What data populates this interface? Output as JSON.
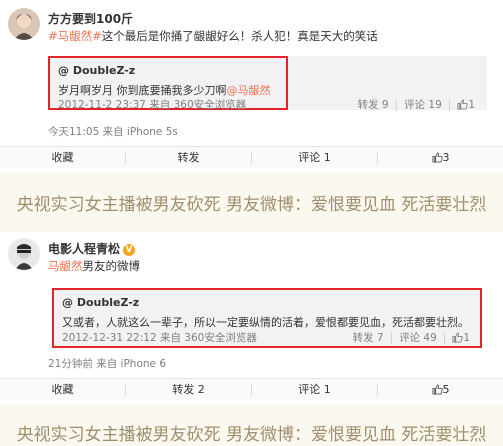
{
  "post1": {
    "author": "方方要到100斤",
    "hashtag": "#马龈然#",
    "text": "这个最后是你捅了龈龈好么！杀人犯！真是天大的笑话",
    "quote": {
      "username": "@ DoubleZ-z",
      "body_prefix": "岁月啊岁月 你到底要捅我多少刀啊",
      "body_tag": "@马龈然",
      "meta": "2012-11-2 23:37 来自 360安全浏览器",
      "repost": "转发 9",
      "comment": "评论 19",
      "likes": "1"
    },
    "meta": "今天11:05 来自 iPhone 5s",
    "actions": {
      "collect": "收藏",
      "repost": "转发",
      "comment": "评论 1",
      "likes": "3"
    }
  },
  "caption1": "央视实习女主播被男友砍死  男友微博：爱恨要见血  死活要壮烈",
  "post2": {
    "author": "电影人程青松",
    "verified_badge": "V",
    "text_tag": "马龈然",
    "text_rest": "男友的微博",
    "quote": {
      "username": "@ DoubleZ-z",
      "body": "又或者，人就这么一辈子，所以一定要纵情的活着，爱恨都要见血，死活都要壮烈。",
      "meta": "2012-12-31 22:12 来自 360安全浏览器",
      "repost": "转发 7",
      "comment": "评论 49",
      "likes": "1"
    },
    "meta": "21分钟前 来自 iPhone 6",
    "actions": {
      "collect": "收藏",
      "repost": "转发 2",
      "comment": "评论 1",
      "likes": "5"
    }
  },
  "caption2": "央视实习女主播被男友砍死  男友微博：爱恨要见血  死活要壮烈",
  "colors": {
    "tag": "#eb7350",
    "highlight_border": "#e0242a",
    "caption_text": "#a08f6e"
  }
}
